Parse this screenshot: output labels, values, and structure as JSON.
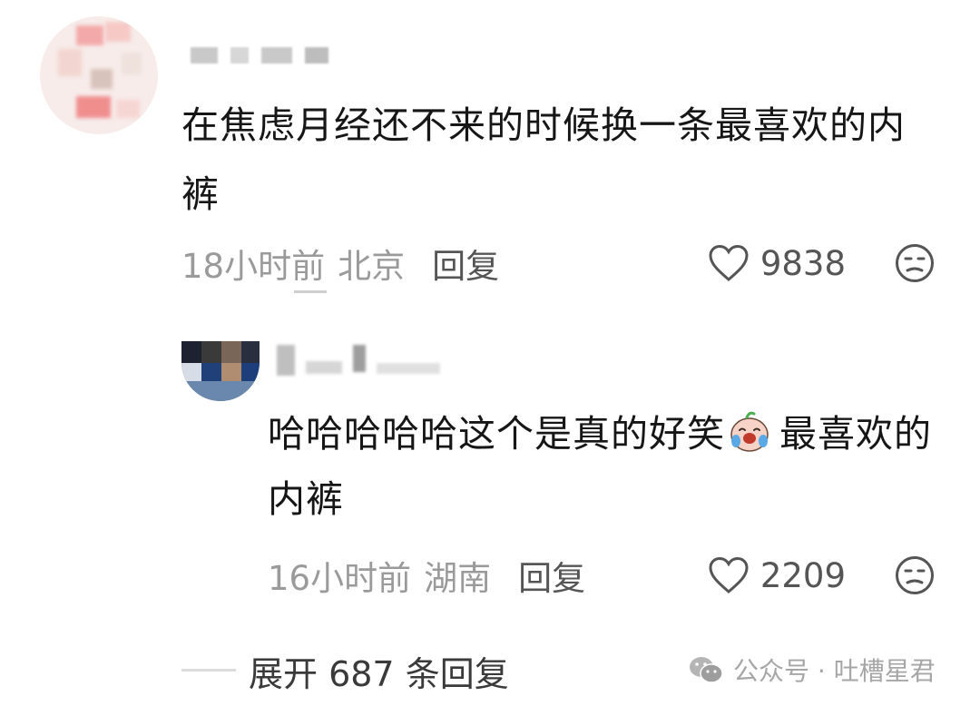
{
  "comment": {
    "text": "在焦虑月经还不来的时候换一条最喜欢的内裤",
    "time": "18小时前",
    "location": "北京",
    "reply_label": "回复",
    "likes": "9838"
  },
  "reply": {
    "text_before_emoji": "哈哈哈哈哈这个是真的好笑",
    "text_after_emoji": "最喜欢的内裤",
    "time": "16小时前",
    "location": "湖南",
    "reply_label": "回复",
    "likes": "2209",
    "emoji": "laughing-crying-emoji"
  },
  "expand": {
    "label": "展开 687 条回复"
  },
  "watermark": {
    "text": "公众号 · 吐槽星君",
    "icon": "wechat-icon"
  },
  "colors": {
    "meta_gray": "#9a9a9a",
    "text_dark": "#161616",
    "action_gray": "#555555"
  }
}
